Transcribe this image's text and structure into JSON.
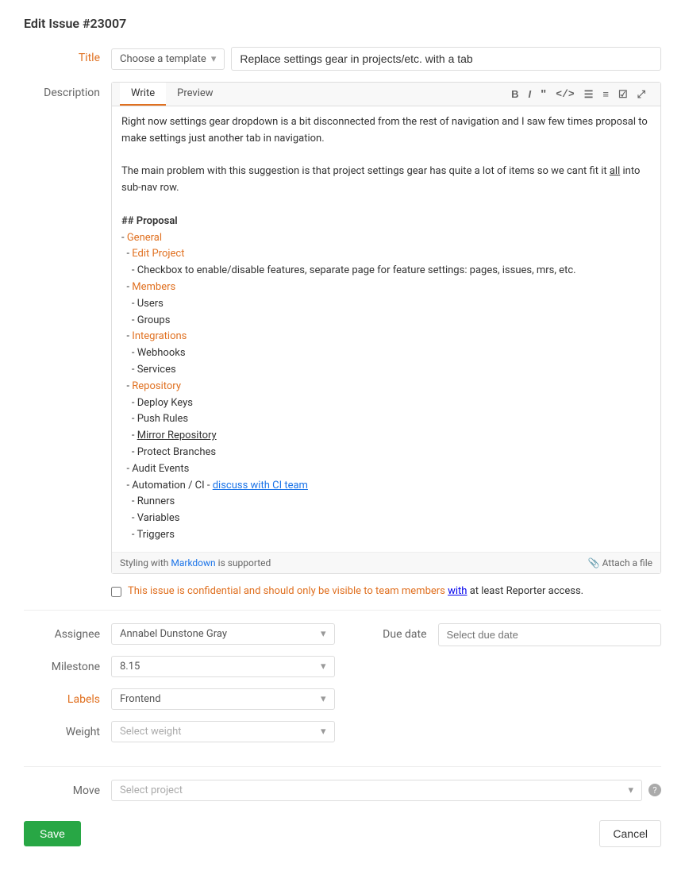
{
  "page": {
    "title": "Edit Issue #23007"
  },
  "title_field": {
    "template_label": "Choose a template",
    "title_value": "Replace settings gear in projects/etc. with a tab"
  },
  "description": {
    "write_tab": "Write",
    "preview_tab": "Preview",
    "content_lines": [
      "Right now settings gear dropdown is a bit disconnected from the rest of navigation and I saw few times proposal to make settings just another tab in navigation.",
      "",
      "The main problem with this suggestion is that project settings gear has quite a lot of items so we cant fit it all into sub-nav row.",
      "",
      "## Proposal",
      "- General",
      "  - Edit Project",
      "    - Checkbox to enable/disable features, separate page for feature settings: pages, issues, mrs, etc.",
      "  - Members",
      "    - Users",
      "    - Groups",
      "  - Integrations",
      "    - Webhooks",
      "    - Services",
      "  - Repository",
      "    - Deploy Keys",
      "    - Push Rules",
      "    - Mirror Repository",
      "    - Protect Branches",
      "  - Audit Events",
      "  - Automation / CI - discuss with CI team",
      "    - Runners",
      "    - Variables",
      "    - Triggers"
    ],
    "footer_text": "Styling with",
    "markdown_link": "Markdown",
    "markdown_suffix": "is supported",
    "attach_label": "Attach a file"
  },
  "confidential": {
    "text_before": "This issue is confidential and should only be visible to team members",
    "link_text": "with",
    "text_after": "at least Reporter access."
  },
  "assignee": {
    "label": "Assignee",
    "value": "Annabel Dunstone Gray"
  },
  "due_date": {
    "label": "Due date",
    "placeholder": "Select due date"
  },
  "milestone": {
    "label": "Milestone",
    "value": "8.15"
  },
  "labels": {
    "label": "Labels",
    "value": "Frontend"
  },
  "weight": {
    "label": "Weight",
    "placeholder": "Select weight"
  },
  "move": {
    "label": "Move",
    "placeholder": "Select project"
  },
  "buttons": {
    "save": "Save",
    "cancel": "Cancel"
  }
}
